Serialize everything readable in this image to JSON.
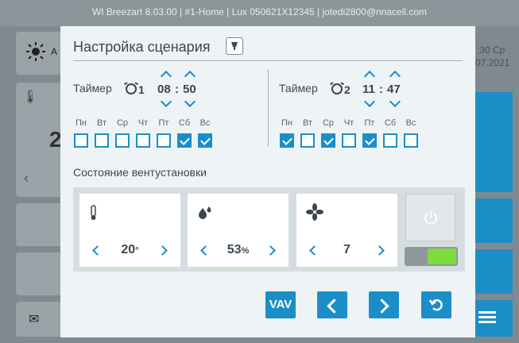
{
  "window": {
    "title": "WI Breezart 8.03.00 | #1-Home | Lux 050621X12345 | jotedi2800@nnacell.com"
  },
  "background": {
    "time_fragment": ":30 Ср",
    "date_fragment": "07.2021",
    "temp_fragment": "2",
    "letter_fragment": "A"
  },
  "dialog": {
    "title": "Настройка сценария",
    "timers": [
      {
        "label": "Таймер",
        "num": "1",
        "hours": "08",
        "minutes": "50",
        "sep": ":",
        "days": [
          {
            "name": "Пн",
            "checked": false
          },
          {
            "name": "Вт",
            "checked": false
          },
          {
            "name": "Ср",
            "checked": false
          },
          {
            "name": "Чт",
            "checked": false
          },
          {
            "name": "Пт",
            "checked": false
          },
          {
            "name": "Сб",
            "checked": true
          },
          {
            "name": "Вс",
            "checked": true
          }
        ]
      },
      {
        "label": "Таймер",
        "num": "2",
        "hours": "11",
        "minutes": "47",
        "sep": ":",
        "days": [
          {
            "name": "Пн",
            "checked": true
          },
          {
            "name": "Вт",
            "checked": false
          },
          {
            "name": "Ср",
            "checked": true
          },
          {
            "name": "Чт",
            "checked": false
          },
          {
            "name": "Пт",
            "checked": true
          },
          {
            "name": "Сб",
            "checked": false
          },
          {
            "name": "Вс",
            "checked": false
          }
        ]
      }
    ],
    "section_title": "Состояние вентустановки",
    "temperature": {
      "value": "20",
      "unit": "°"
    },
    "humidity": {
      "value": "53",
      "unit": "%"
    },
    "fan": {
      "value": "7"
    },
    "power_switch_on": true,
    "buttons": {
      "vav": "VAV"
    },
    "colors": {
      "accent": "#1b8ec8",
      "switch_on": "#7edc3e",
      "dialog_bg": "#eef3f6"
    }
  }
}
